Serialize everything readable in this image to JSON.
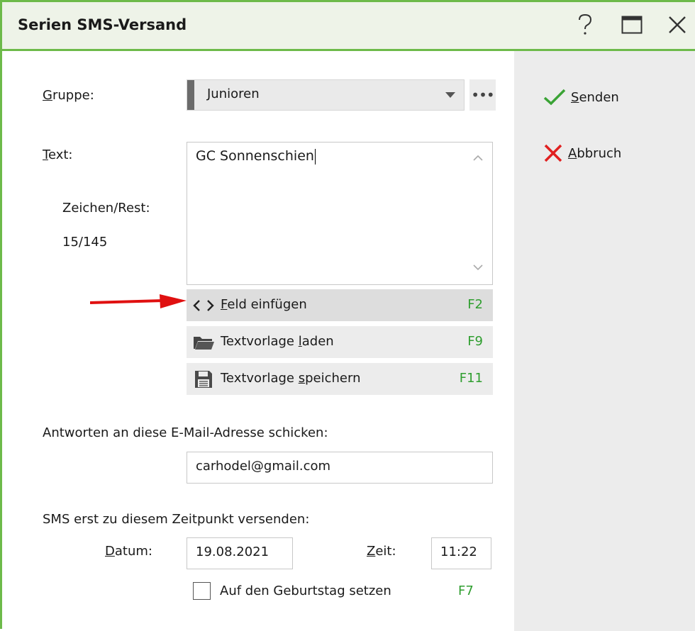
{
  "window": {
    "title": "Serien SMS-Versand",
    "buttons": {
      "help": "?",
      "maximize": "maximize",
      "close": "close"
    }
  },
  "sidebar": {
    "send": {
      "label_underline": "S",
      "label_rest": "enden",
      "icon": "checkmark-icon",
      "color": "#3aa335"
    },
    "cancel": {
      "label_underline": "A",
      "label_rest": "bbruch",
      "icon": "x-icon",
      "color": "#e02020"
    }
  },
  "form": {
    "group": {
      "label_underline": "G",
      "label_rest": "ruppe:",
      "value": "Junioren",
      "more": "•••"
    },
    "text": {
      "label_underline": "T",
      "label_rest": "ext:",
      "value": "GC Sonnenschien",
      "counter_label": "Zeichen/Rest:",
      "counter_value": "15/145"
    },
    "actions": [
      {
        "label_before": "",
        "label_underline": "F",
        "label_after": "eld einfügen",
        "key": "F2",
        "icon": "code-brackets-icon"
      },
      {
        "label_before": "Textvorlage ",
        "label_underline": "l",
        "label_after": "aden",
        "key": "F9",
        "icon": "folder-icon"
      },
      {
        "label_before": "Textvorlage ",
        "label_underline": "s",
        "label_after": "peichern",
        "key": "F11",
        "icon": "save-icon"
      }
    ],
    "reply": {
      "label": "Antworten an diese E-Mail-Adresse schicken:",
      "value": "carhodel@gmail.com"
    },
    "schedule": {
      "label": "SMS erst zu diesem Zeitpunkt versenden:",
      "date_label_underline": "D",
      "date_label_rest": "atum:",
      "date_value": "19.08.2021",
      "time_label_underline": "Z",
      "time_label_rest": "eit:",
      "time_value": "11:22",
      "birthday_label": "Auf den Geburtstag setzen",
      "birthday_key": "F7"
    }
  },
  "colors": {
    "accent": "#6dba4a",
    "shortcut": "#2f9e2f",
    "annotation_arrow": "#e01010"
  }
}
